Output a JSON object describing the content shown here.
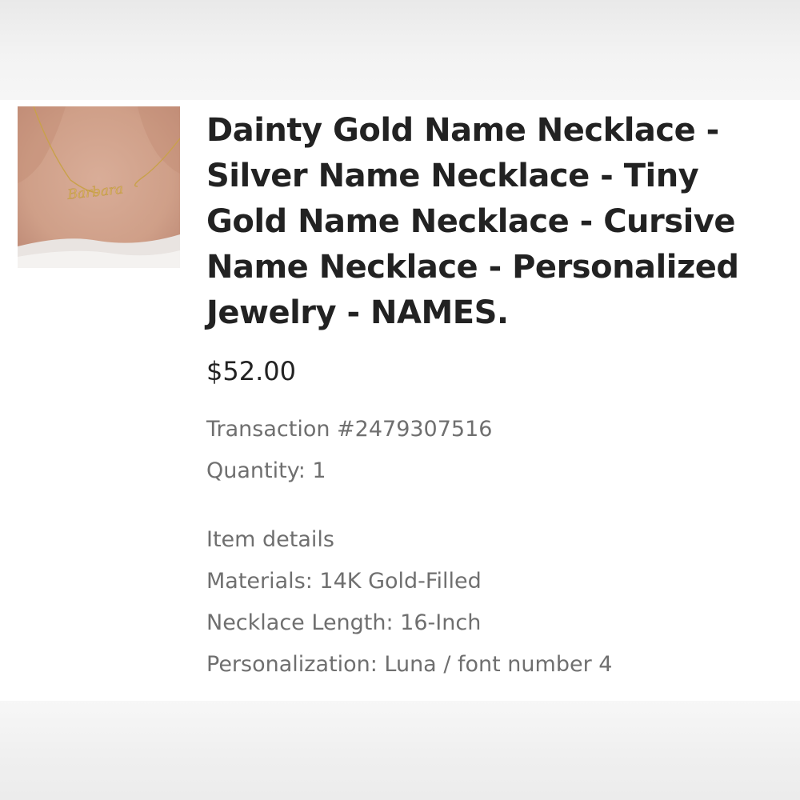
{
  "product": {
    "image_alt": "Gold name necklace with cursive name Barbara",
    "pendant_text": "Barbara",
    "title_lines": [
      "Dainty Gold Name Necklace -",
      "Silver Name Necklace - Tiny",
      "Gold Name Necklace - Cursive",
      "Name Necklace - Personalized",
      "Jewelry - NAMES."
    ],
    "price": "$52.00"
  },
  "transaction": {
    "number": "Transaction #2479307516",
    "quantity": "Quantity: 1"
  },
  "item_details": {
    "heading": "Item details",
    "materials": "Materials: 14K Gold-Filled",
    "length": "Necklace Length: 16-Inch",
    "personalization": "Personalization: Luna / font number 4"
  },
  "colors": {
    "title": "#222222",
    "meta": "#6f6f6f",
    "gold": "#c9a14a"
  }
}
